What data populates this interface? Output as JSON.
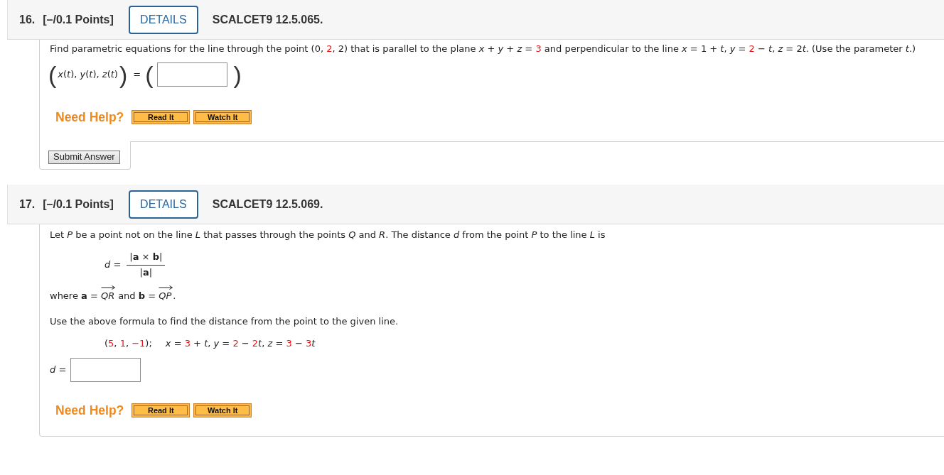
{
  "questions": [
    {
      "number": "16.",
      "points": "[–/0.1 Points]",
      "details_button": "DETAILS",
      "code": "SCALCET9 12.5.065.",
      "blocks": [
        {
          "kind": "paragraph",
          "segments": [
            {
              "kind": "text",
              "text": "Find parametric equations for the line through the point (0, "
            },
            {
              "kind": "value",
              "text": "2"
            },
            {
              "kind": "text",
              "text": ", 2) that is parallel to the plane *x* + *y* + *z* = "
            },
            {
              "kind": "value",
              "text": "3"
            },
            {
              "kind": "text",
              "text": " and perpendicular to the line *x* = 1 + *t*, *y* = "
            },
            {
              "kind": "value",
              "text": "2"
            },
            {
              "kind": "text",
              "text": " − *t*, *z* = 2"
            },
            {
              "kind": "text",
              "text": "*t*. (Use the parameter *t*.)"
            }
          ]
        },
        {
          "kind": "tuple_answer",
          "lhs_open": "(",
          "lhs": "*x*(*t*), *y*(*t*), *z*(*t*)",
          "lhs_close": ")",
          "equals": "=",
          "rhs_open": "(",
          "rhs_close": ")"
        }
      ],
      "help": {
        "label": "Need Help?",
        "buttons": [
          "Read It",
          "Watch It"
        ]
      },
      "submit_button": "Submit Answer"
    },
    {
      "number": "17.",
      "points": "[–/0.1 Points]",
      "details_button": "DETAILS",
      "code": "SCALCET9 12.5.069.",
      "blocks": [
        {
          "kind": "paragraph",
          "segments": [
            {
              "kind": "text",
              "text": "Let *P* be a point not on the line *L* that passes through the points *Q* and *R*. The distance *d* from the point *P* to the line *L* is"
            }
          ]
        },
        {
          "kind": "fraction",
          "lhs": "*d* =",
          "numerator": "|**a** × **b**|",
          "denominator": "|**a**|"
        },
        {
          "kind": "vector_line",
          "segments": [
            {
              "kind": "text",
              "text": "where **a** = "
            },
            {
              "kind": "vector",
              "text": "*QR*"
            },
            {
              "kind": "text",
              "text": " and **b** = "
            },
            {
              "kind": "vector",
              "text": "*QP*"
            },
            {
              "kind": "text",
              "text": "."
            }
          ]
        },
        {
          "kind": "paragraph",
          "segments": [
            {
              "kind": "text",
              "text": "Use the above formula to find the distance from the point to the given line."
            }
          ]
        },
        {
          "kind": "data",
          "parts": [
            {
              "segments": [
                {
                  "kind": "text",
                  "text": "("
                },
                {
                  "kind": "value",
                  "text": "5"
                },
                {
                  "kind": "text",
                  "text": ", "
                },
                {
                  "kind": "value",
                  "text": "1"
                },
                {
                  "kind": "text",
                  "text": ", "
                },
                {
                  "kind": "value",
                  "text": "−1"
                },
                {
                  "kind": "text",
                  "text": ");"
                }
              ]
            },
            {
              "segments": [
                {
                  "kind": "text",
                  "text": "*x* = "
                },
                {
                  "kind": "value",
                  "text": "3"
                },
                {
                  "kind": "text",
                  "text": " + *t*, *y* = "
                },
                {
                  "kind": "value",
                  "text": "2"
                },
                {
                  "kind": "text",
                  "text": " − "
                },
                {
                  "kind": "value",
                  "text": "2"
                },
                {
                  "kind": "text",
                  "text": "*t*, *z* = "
                },
                {
                  "kind": "value",
                  "text": "3"
                },
                {
                  "kind": "text",
                  "text": " − "
                },
                {
                  "kind": "value",
                  "text": "3"
                },
                {
                  "kind": "text",
                  "text": "*t*"
                }
              ]
            }
          ]
        },
        {
          "kind": "field_answer",
          "label": "*d* ="
        }
      ],
      "help": {
        "label": "Need Help?",
        "buttons": [
          "Read It",
          "Watch It"
        ]
      }
    }
  ]
}
